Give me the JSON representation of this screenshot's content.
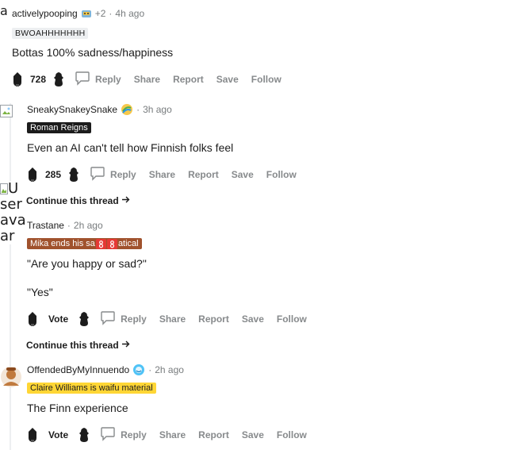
{
  "comments": [
    {
      "username": "activelypooping",
      "extra_awards": "+2",
      "time": "4h ago",
      "flair": "BWOAHHHHHHH",
      "text": "Bottas 100% sadness/happiness",
      "score": "728"
    },
    {
      "username": "SneakySnakeySnake",
      "time": "3h ago",
      "flair": "Roman Reigns",
      "text": "Even an AI can't tell how Finnish folks feel",
      "score": "285"
    },
    {
      "username": "Trastane",
      "time": "2h ago",
      "flair_parts": [
        "Mika ends his sa",
        "atical"
      ],
      "text_lines": [
        "\"Are you happy or sad?\"",
        "\"Yes\""
      ],
      "score": "Vote"
    },
    {
      "username": "OffendedByMyInnuendo",
      "time": "2h ago",
      "flair": "Claire Williams is waifu material",
      "text": "The Finn experience",
      "score": "Vote"
    }
  ],
  "actions": {
    "reply": "Reply",
    "share": "Share",
    "report": "Report",
    "save": "Save",
    "follow": "Follow"
  },
  "continue_thread": "Continue this thread",
  "broken_avatar_top": "a",
  "broken_avatar_lines": [
    "U",
    "ser",
    "ava",
    "ar"
  ],
  "separator": "·",
  "icons": {
    "upvote": "upvote-icon",
    "downvote": "downvote-icon",
    "comment": "comment-bubble-icon",
    "arrow": "arrow-right-icon",
    "award": "award-icon"
  },
  "colors": {
    "flair_gray_bg": "#edeff1",
    "flair_black_bg": "#1c1c1c",
    "flair_brown_bg": "#a0522d",
    "flair_yellow_bg": "#ffd635",
    "muted": "#787c7e",
    "action": "#878a8c"
  }
}
